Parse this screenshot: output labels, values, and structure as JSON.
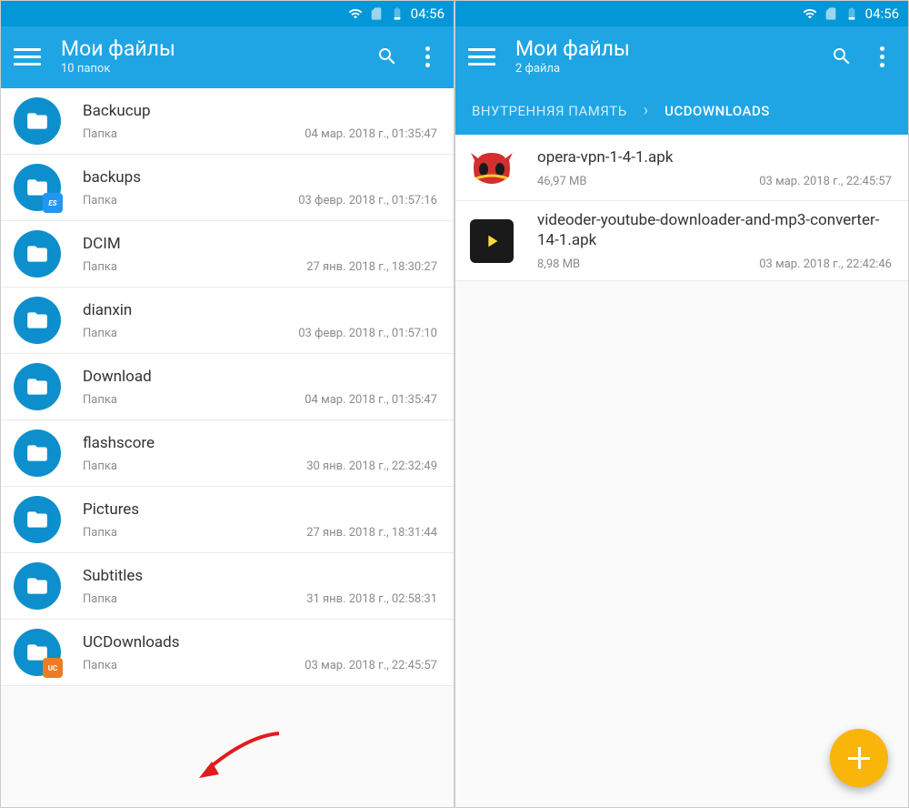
{
  "status": {
    "time": "04:56"
  },
  "left": {
    "title": "Мои файлы",
    "subtitle": "10 папок",
    "folders": [
      {
        "name": "Backucup",
        "type": "Папка",
        "date": "04 мар. 2018 г., 01:35:47",
        "badge": ""
      },
      {
        "name": "backups",
        "type": "Папка",
        "date": "03 февр. 2018 г., 01:57:16",
        "badge": "es"
      },
      {
        "name": "DCIM",
        "type": "Папка",
        "date": "27 янв. 2018 г., 18:30:27",
        "badge": ""
      },
      {
        "name": "dianxin",
        "type": "Папка",
        "date": "03 февр. 2018 г., 01:57:10",
        "badge": ""
      },
      {
        "name": "Download",
        "type": "Папка",
        "date": "04 мар. 2018 г., 01:35:47",
        "badge": ""
      },
      {
        "name": "flashscore",
        "type": "Папка",
        "date": "30 янв. 2018 г., 22:32:49",
        "badge": ""
      },
      {
        "name": "Pictures",
        "type": "Папка",
        "date": "27 янв. 2018 г., 18:31:44",
        "badge": ""
      },
      {
        "name": "Subtitles",
        "type": "Папка",
        "date": "31 янв. 2018 г., 02:58:31",
        "badge": ""
      },
      {
        "name": "UCDownloads",
        "type": "Папка",
        "date": "03 мар. 2018 г., 22:45:57",
        "badge": "uc"
      }
    ]
  },
  "right": {
    "title": "Мои файлы",
    "subtitle": "2 файла",
    "breadcrumb": [
      "ВНУТРЕННЯЯ ПАМЯТЬ",
      "UCDOWNLOADS"
    ],
    "files": [
      {
        "name": "opera-vpn-1-4-1.apk",
        "size": "46,97 MB",
        "date": "03 мар. 2018 г., 22:45:57",
        "icon": "opera"
      },
      {
        "name": "videoder-youtube-downloader-and-mp3-converter-14-1.apk",
        "size": "8,98 MB",
        "date": "03 мар. 2018 г., 22:42:46",
        "icon": "videoder"
      }
    ]
  }
}
